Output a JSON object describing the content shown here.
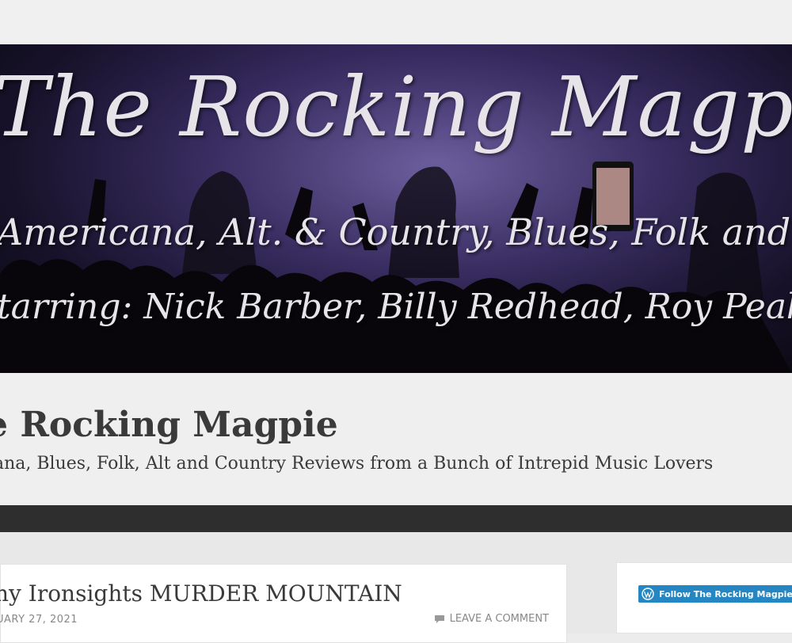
{
  "banner": {
    "title": "The Rocking Magpie",
    "line1": "Americana, Alt. & Country, Blues, Folk and m",
    "line2": "tarring: Nick Barber, Billy Redhead, Roy Peak, Jack Kic"
  },
  "site": {
    "title": "e Rocking Magpie",
    "description": "ana, Blues, Folk, Alt and Country Reviews from a Bunch of Intrepid Music Lovers"
  },
  "post": {
    "title": "ny Ironsights MURDER MOUNTAIN",
    "date": "UARY 27, 2021",
    "comment_label": "LEAVE A COMMENT",
    "comment_icon": "comment-icon"
  },
  "widget": {
    "follow_label": "Follow The Rocking Magpie",
    "follow_icon": "wordpress-icon"
  },
  "colors": {
    "nav_bar": "#2e2e2e",
    "follow_button": "#2487c4",
    "banner_text": "#e6e4e8"
  }
}
